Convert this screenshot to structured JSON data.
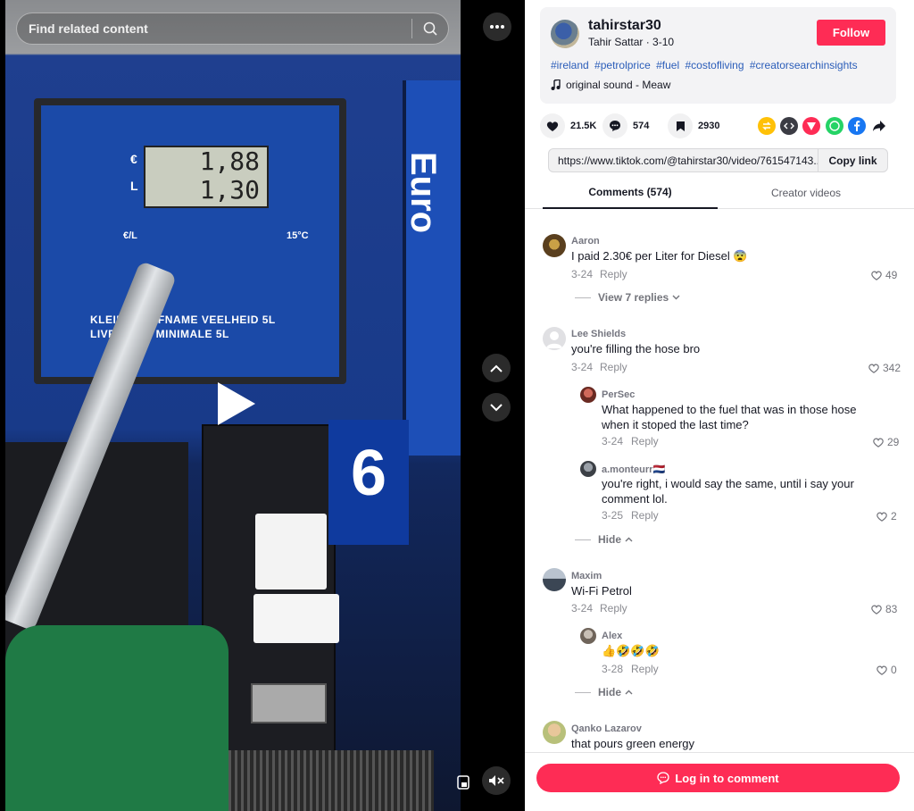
{
  "search": {
    "placeholder": "Find related content",
    "icon": "search-icon"
  },
  "video": {
    "display": {
      "line1": "1,88",
      "line2": "1,30"
    },
    "labels": {
      "euro": "€",
      "liter": "L",
      "ratio": "€/L",
      "temp": "15°C"
    },
    "panel_text": "KLEINSTE AFNAME VEELHEID 5L LIVRAISON MINIMALE 5L",
    "side_text": "Euro",
    "pump_number": "6"
  },
  "author": {
    "username": "tahirstar30",
    "nickname": "Tahir Sattar",
    "date": "3-10",
    "follow_label": "Follow",
    "hashtags": [
      "#ireland",
      "#petrolprice",
      "#fuel",
      "#costofliving",
      "#creatorsearchinsights"
    ],
    "music": "original sound - Meaw"
  },
  "actions": {
    "likes": "21.5K",
    "comments": "574",
    "saves": "2930"
  },
  "share_icons": [
    {
      "name": "repost-icon",
      "color": "#ffc107"
    },
    {
      "name": "embed-icon",
      "color": "#3b3c44"
    },
    {
      "name": "send-icon",
      "color": "#fe2c55"
    },
    {
      "name": "whatsapp-icon",
      "color": "#25d366"
    },
    {
      "name": "facebook-icon",
      "color": "#1877f2"
    }
  ],
  "link": {
    "url": "https://www.tiktok.com/@tahirstar30/video/761547143...",
    "copy_label": "Copy link"
  },
  "tabs": [
    {
      "label": "Comments (574)"
    },
    {
      "label": "Creator videos"
    }
  ],
  "comments": [
    {
      "name": "Aaron",
      "text": "I paid 2.30€ per Liter for Diesel 😨",
      "date": "3-24",
      "reply": "Reply",
      "likes": "49",
      "toggle": "View 7 replies"
    },
    {
      "name": "Lee Shields",
      "text": "you're filling the hose bro",
      "date": "3-24",
      "reply": "Reply",
      "likes": "342",
      "replies": [
        {
          "name": "PerSec",
          "text": "What happened to the fuel that was in those hose when it stoped the last time?",
          "date": "3-24",
          "reply": "Reply",
          "likes": "29"
        },
        {
          "name": "a.monteurr🇳🇱",
          "text": "you're right, i would say the same, until i say your comment lol.",
          "date": "3-25",
          "reply": "Reply",
          "likes": "2"
        }
      ],
      "toggle": "Hide"
    },
    {
      "name": "Maxim",
      "text": "Wi-Fi Petrol",
      "date": "3-24",
      "reply": "Reply",
      "likes": "83",
      "replies": [
        {
          "name": "Alex",
          "text": "👍🤣🤣🤣",
          "date": "3-28",
          "reply": "Reply",
          "likes": "0"
        }
      ],
      "toggle": "Hide"
    },
    {
      "name": "Qanko Lazarov",
      "text": "that pours green energy"
    }
  ],
  "login_label": "Log in to comment"
}
